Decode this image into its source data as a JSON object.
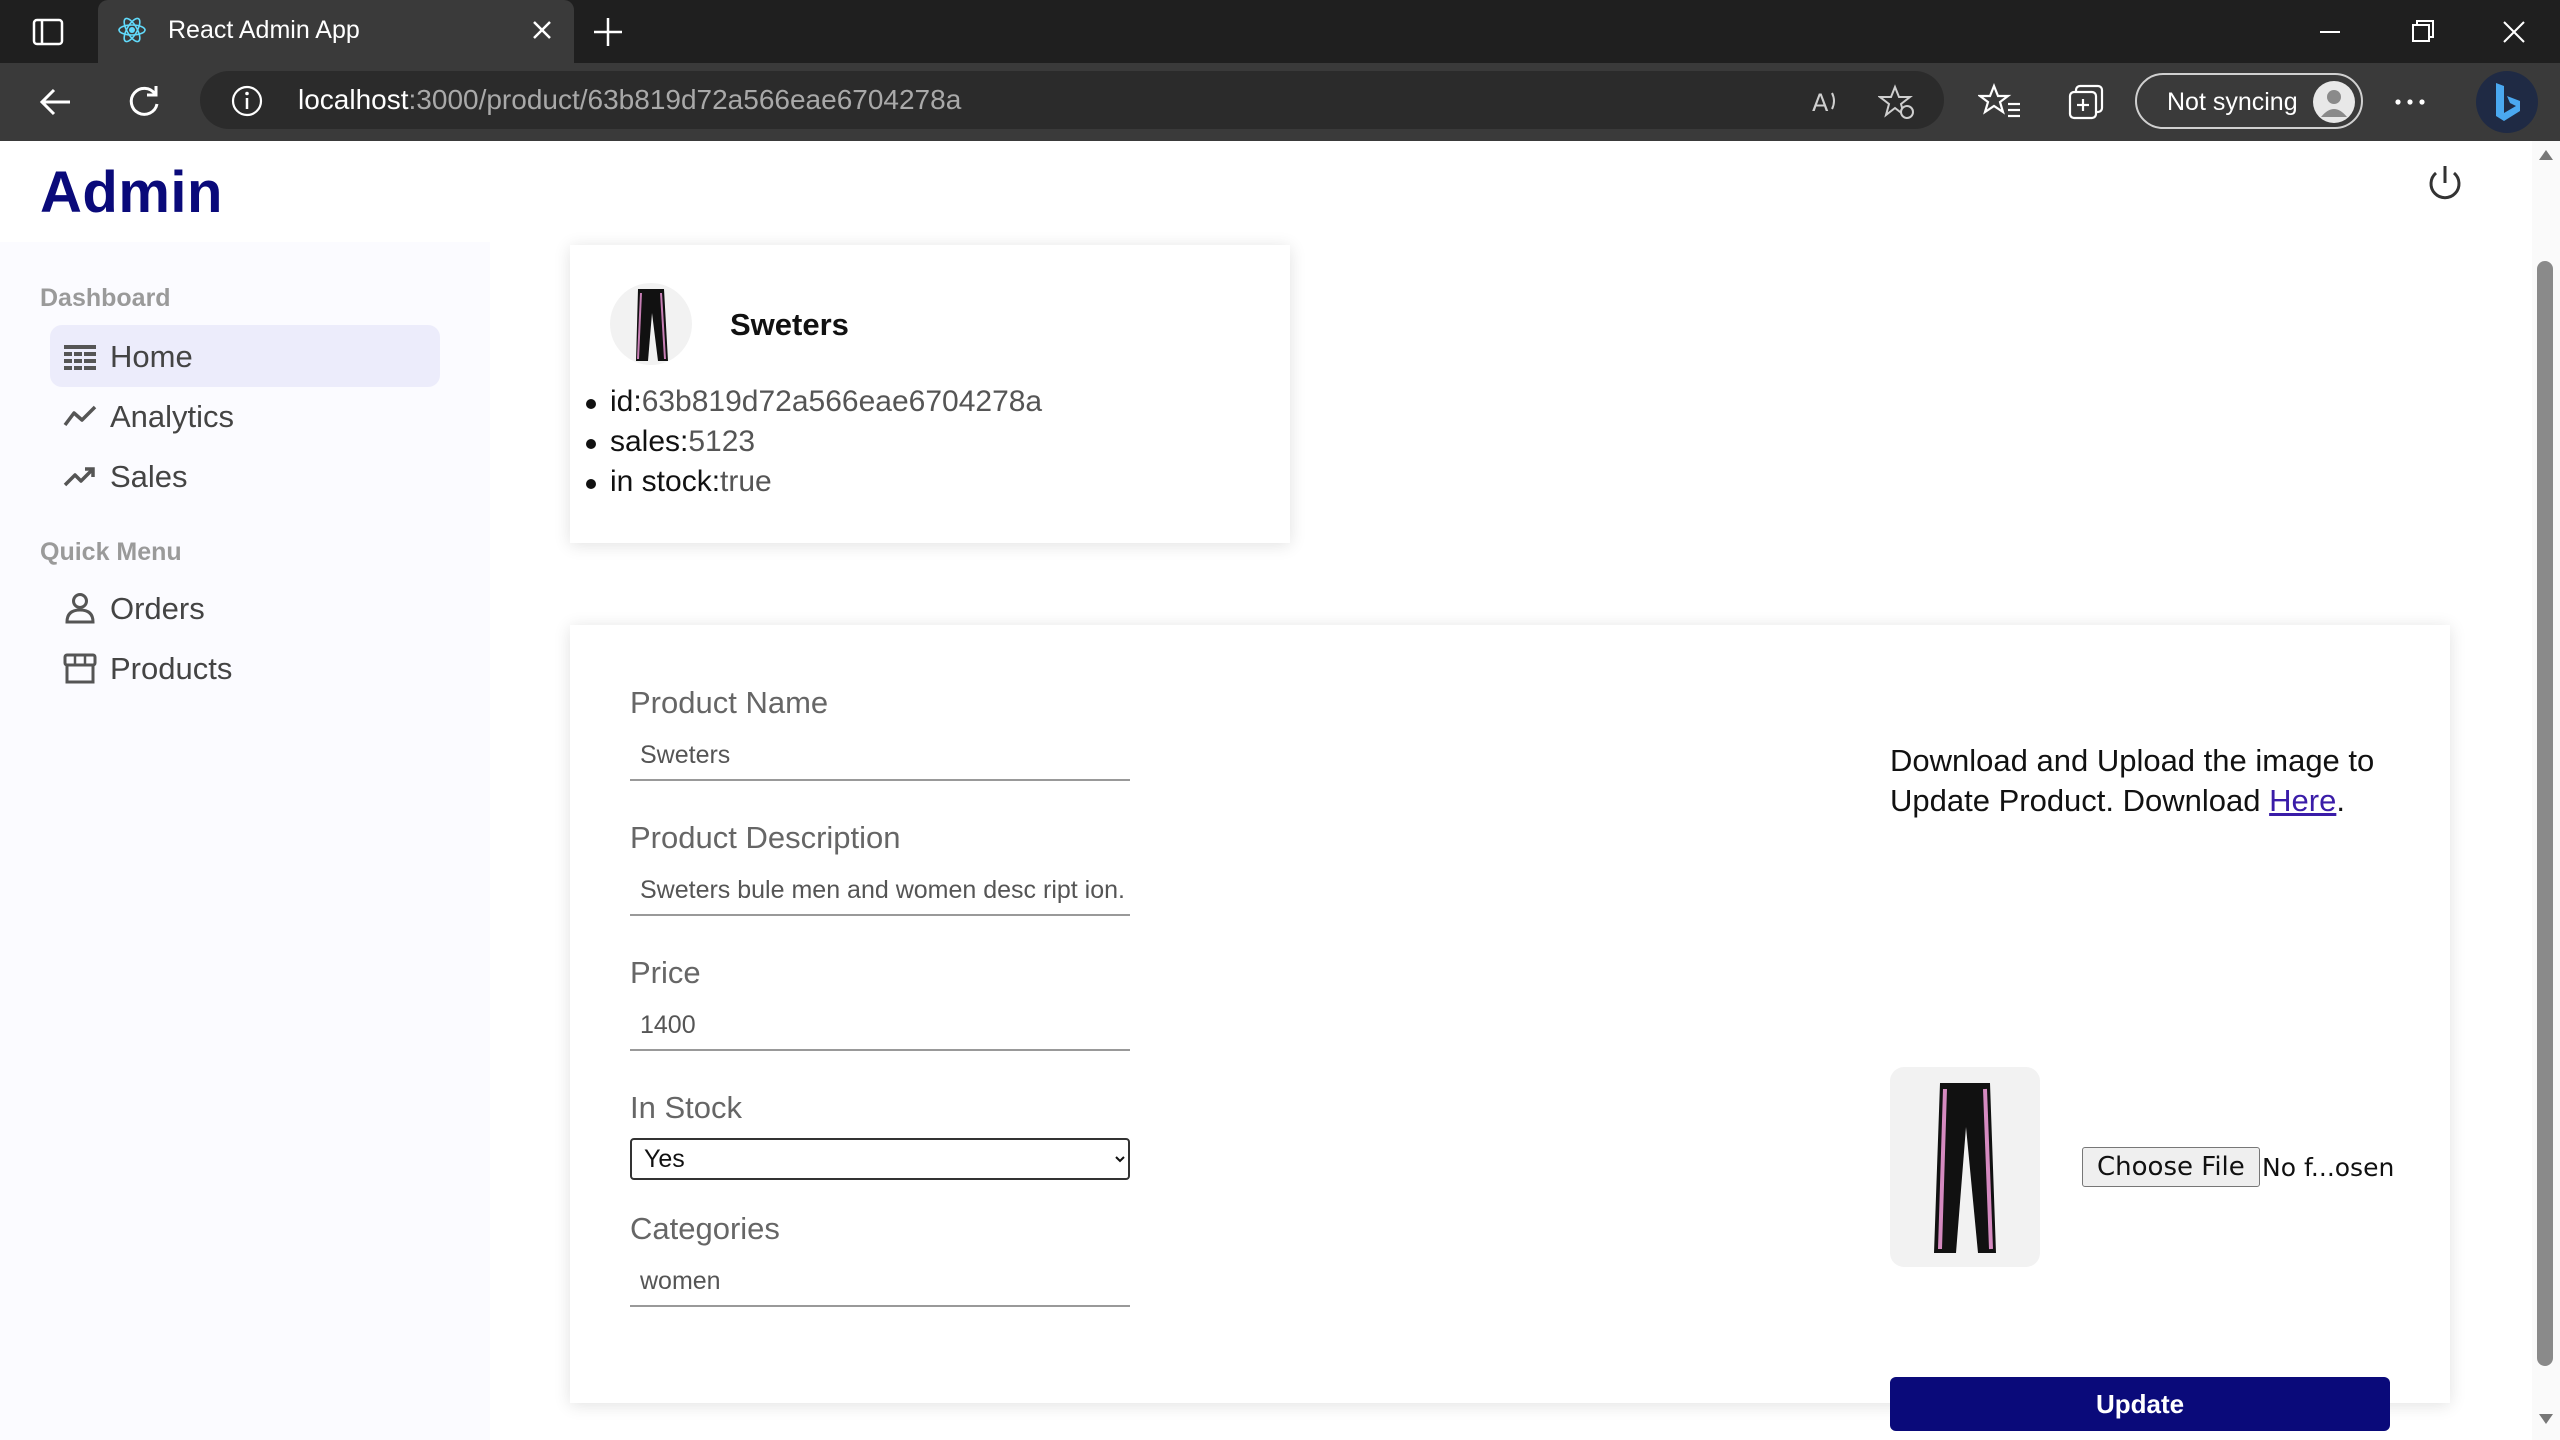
{
  "browser": {
    "tab_title": "React Admin App",
    "url_host": "localhost",
    "url_rest": ":3000/product/63b819d72a566eae6704278a",
    "sync_label": "Not syncing"
  },
  "app": {
    "logo": "Admin"
  },
  "sidebar": {
    "sections": [
      {
        "title": "Dashboard",
        "items": [
          {
            "label": "Home",
            "icon": "home-icon",
            "active": true
          },
          {
            "label": "Analytics",
            "icon": "timeline-icon"
          },
          {
            "label": "Sales",
            "icon": "trending-up-icon"
          }
        ]
      },
      {
        "title": "Quick Menu",
        "items": [
          {
            "label": "Orders",
            "icon": "person-icon"
          },
          {
            "label": "Products",
            "icon": "storefront-icon"
          }
        ]
      }
    ]
  },
  "product": {
    "name": "Sweters",
    "info": [
      {
        "key": "id:",
        "value": "63b819d72a566eae6704278a"
      },
      {
        "key": "sales:",
        "value": "5123"
      },
      {
        "key": "in stock:",
        "value": "true"
      }
    ]
  },
  "form": {
    "name_label": "Product Name",
    "name_value": "Sweters",
    "desc_label": "Product Description",
    "desc_value": "Sweters bule men and women desc ript ion.",
    "price_label": "Price",
    "price_value": "1400",
    "stock_label": "In Stock",
    "stock_value": "Yes",
    "cat_label": "Categories",
    "cat_value": "women",
    "upload_text": "Download and Upload the image to Update Product. Download ",
    "upload_link": "Here",
    "upload_after": ".",
    "choose_file": "Choose File",
    "no_file": "No f...osen",
    "update_label": "Update"
  },
  "colors": {
    "brand": "#0a0a7a",
    "sidebar_active": "#ececfb"
  }
}
